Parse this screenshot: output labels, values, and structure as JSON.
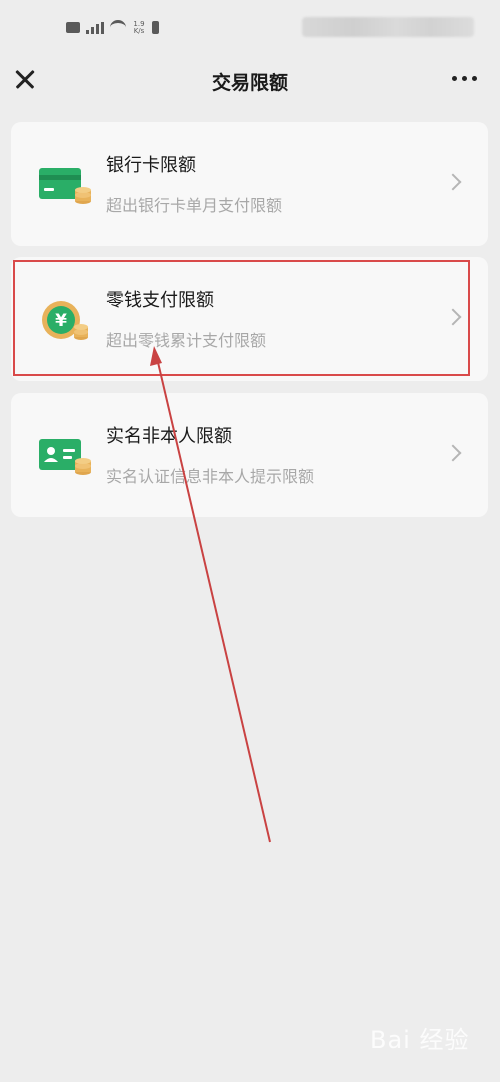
{
  "status_bar": {
    "speed": "1.9 K/s"
  },
  "nav": {
    "title": "交易限额"
  },
  "items": [
    {
      "title": "银行卡限额",
      "subtitle": "超出银行卡单月支付限额",
      "icon": "bank-card-coins-icon"
    },
    {
      "title": "零钱支付限额",
      "subtitle": "超出零钱累计支付限额",
      "icon": "yuan-coin-icon"
    },
    {
      "title": "实名非本人限额",
      "subtitle": "实名认证信息非本人提示限额",
      "icon": "id-card-coins-icon"
    }
  ],
  "watermark": "Bai 经验",
  "colors": {
    "brand_green": "#2aae67",
    "coin_gold": "#e8b25a",
    "annotation_red": "#d94a4a",
    "background": "#ededed"
  }
}
